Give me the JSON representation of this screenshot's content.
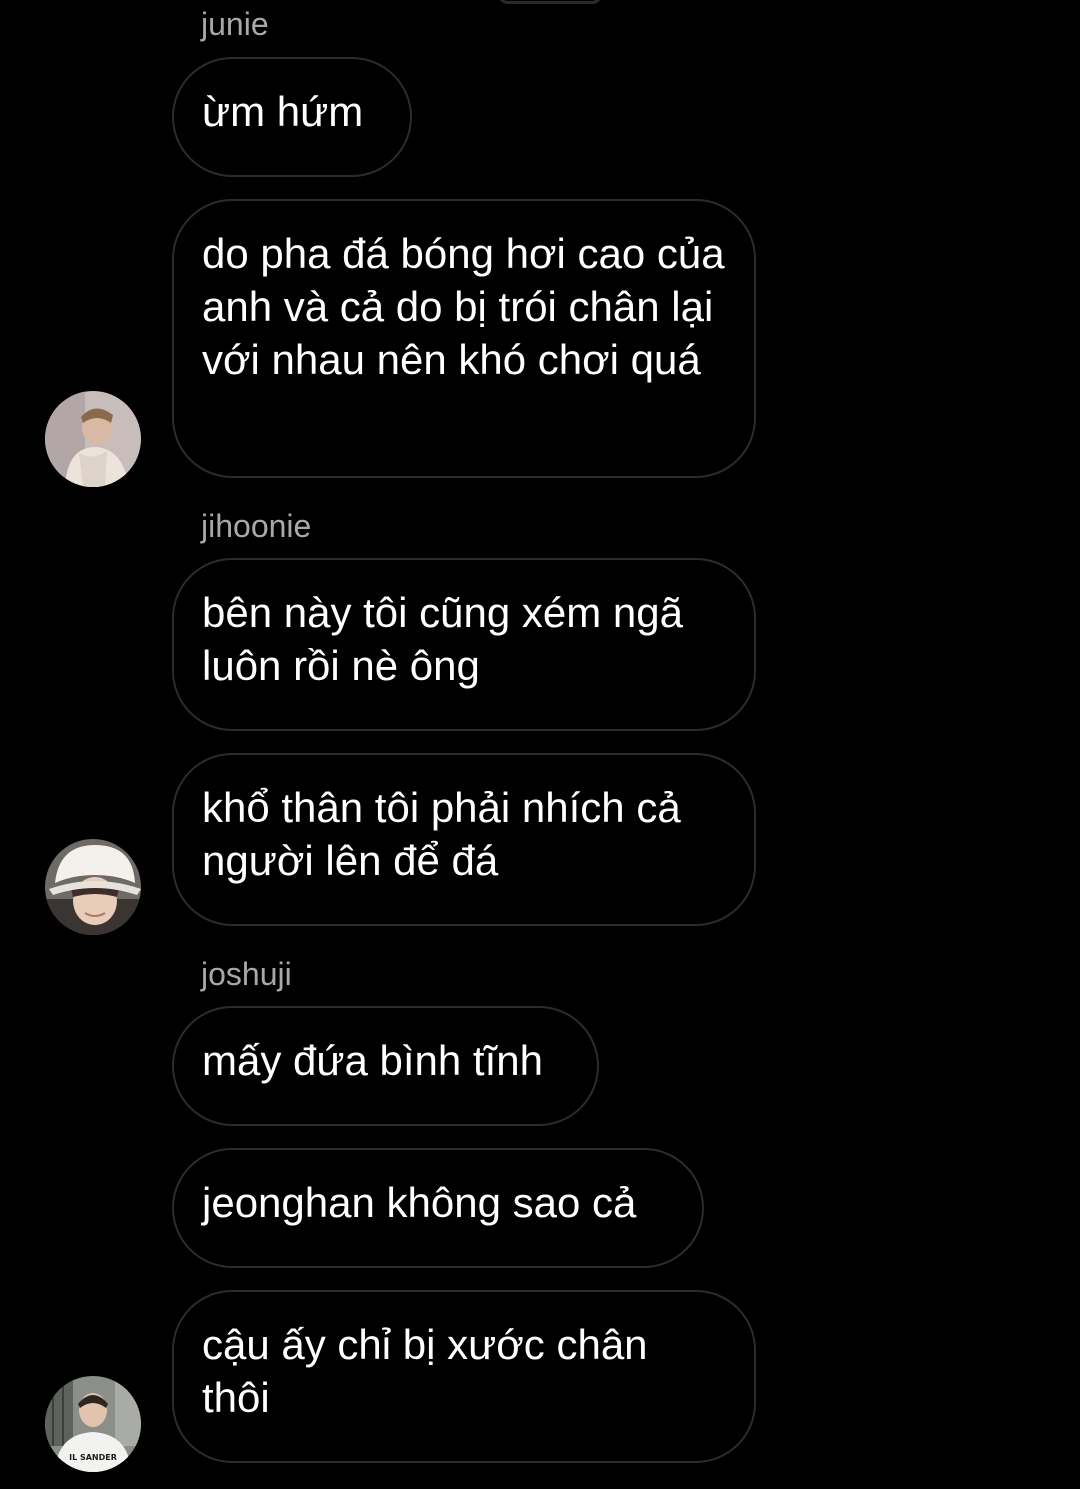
{
  "conversation": {
    "groups": [
      {
        "sender": "junie",
        "messages": [
          "ừm hứm",
          "do pha đá bóng hơi cao của anh và cả do bị trói chân lại với nhau nên khó chơi quá"
        ]
      },
      {
        "sender": "jihoonie",
        "messages": [
          "bên này tôi cũng xém ngã luôn rồi nè ông",
          "khổ thân tôi phải nhích cả người lên để đá"
        ]
      },
      {
        "sender": "joshuji",
        "messages": [
          "mấy đứa bình tĩnh",
          "jeonghan không sao cả",
          "cậu ấy chỉ bị xước chân thôi"
        ]
      }
    ],
    "avatar_shirt_text": "IL SANDER"
  },
  "colors": {
    "background": "#000000",
    "bubble_border": "#2c2c2c",
    "sender_text": "#a8a8a8",
    "message_text": "#ffffff"
  }
}
